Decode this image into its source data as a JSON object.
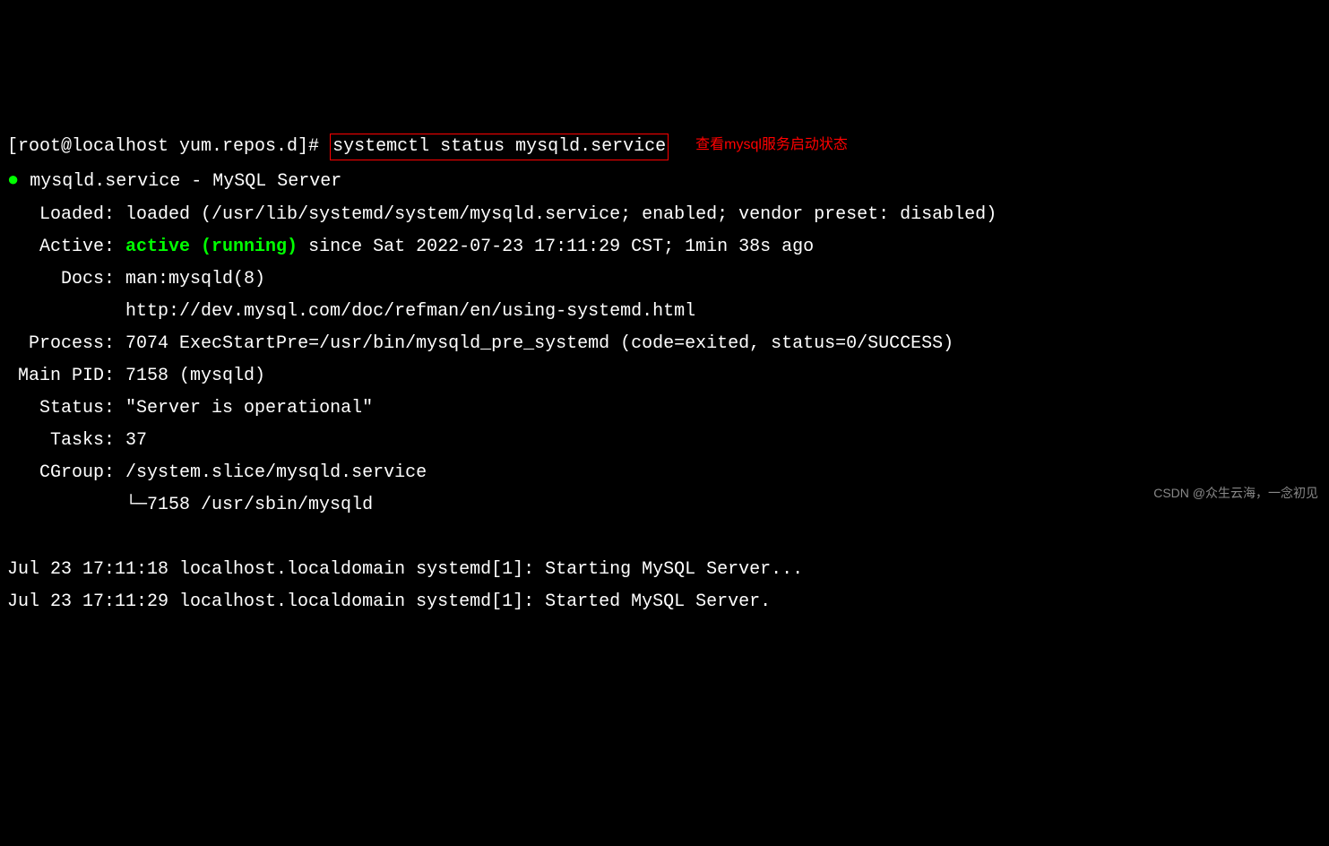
{
  "prompt": "[root@localhost yum.repos.d]# ",
  "command": "systemctl status mysqld.service",
  "annotation": "查看mysql服务启动状态",
  "service_line": "mysqld.service - MySQL Server",
  "loaded_label": "   Loaded: ",
  "loaded_value": "loaded (/usr/lib/systemd/system/mysqld.service; enabled; vendor preset: disabled)",
  "active_label": "   Active: ",
  "active_status": "active (running)",
  "active_since": " since Sat 2022-07-23 17:11:29 CST; 1min 38s ago",
  "docs_label": "     Docs: ",
  "docs_line1": "man:mysqld(8)",
  "docs_line2": "           http://dev.mysql.com/doc/refman/en/using-systemd.html",
  "process_label": "  Process: ",
  "process_value": "7074 ExecStartPre=/usr/bin/mysqld_pre_systemd (code=exited, status=0/SUCCESS)",
  "mainpid_label": " Main PID: ",
  "mainpid_value": "7158 (mysqld)",
  "status_label": "   Status: ",
  "status_value": "\"Server is operational\"",
  "tasks_label": "    Tasks: ",
  "tasks_value": "37",
  "cgroup_label": "   CGroup: ",
  "cgroup_value": "/system.slice/mysqld.service",
  "cgroup_child": "           └─7158 /usr/sbin/mysqld",
  "log1": "Jul 23 17:11:18 localhost.localdomain systemd[1]: Starting MySQL Server...",
  "log2": "Jul 23 17:11:29 localhost.localdomain systemd[1]: Started MySQL Server.",
  "watermark": "CSDN @众生云海，一念初见"
}
